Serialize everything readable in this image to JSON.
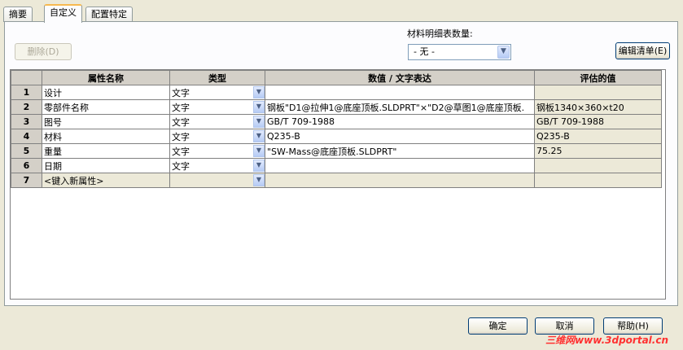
{
  "tabs": [
    "摘要",
    "自定义",
    "配置特定"
  ],
  "delete_button": "删除(D)",
  "bom_qty_label": "材料明细表数量:",
  "bom_qty_value": "- 无 -",
  "edit_list_button": "编辑清单(E)",
  "columns": [
    "属性名称",
    "类型",
    "数值 / 文字表达",
    "评估的值"
  ],
  "rows": [
    {
      "num": "1",
      "name": "设计",
      "type": "文字",
      "value": "",
      "eval": ""
    },
    {
      "num": "2",
      "name": "零部件名称",
      "type": "文字",
      "value": "钢板\"D1@拉伸1@底座顶板.SLDPRT\"×\"D2@草图1@底座顶板.",
      "eval": "钢板1340×360×t20"
    },
    {
      "num": "3",
      "name": "图号",
      "type": "文字",
      "value": "GB/T 709-1988",
      "eval": "GB/T 709-1988"
    },
    {
      "num": "4",
      "name": "材料",
      "type": "文字",
      "value": "Q235-B",
      "eval": "Q235-B"
    },
    {
      "num": "5",
      "name": "重量",
      "type": "文字",
      "value": "\"SW-Mass@底座顶板.SLDPRT\"",
      "eval": "75.25"
    },
    {
      "num": "6",
      "name": "日期",
      "type": "文字",
      "value": "",
      "eval": ""
    },
    {
      "num": "7",
      "name": "<键入新属性>",
      "type": "",
      "value": "",
      "eval": ""
    }
  ],
  "ok_button": "确定",
  "cancel_button": "取消",
  "help_button": "帮助(H)",
  "watermark": "三维网www.3dportal.cn"
}
